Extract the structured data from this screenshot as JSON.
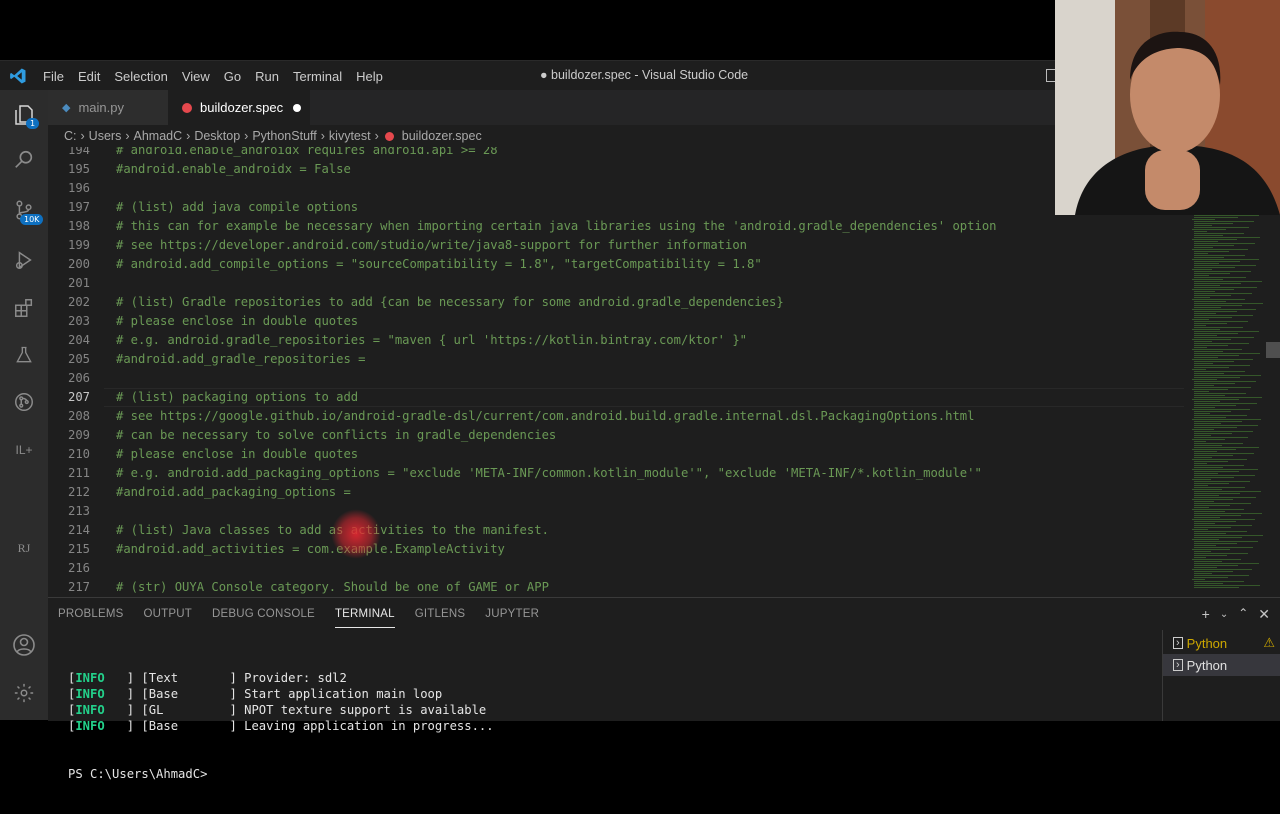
{
  "app": {
    "window_title": "● buildozer.spec - Visual Studio Code",
    "menu": [
      "File",
      "Edit",
      "Selection",
      "View",
      "Go",
      "Run",
      "Terminal",
      "Help"
    ]
  },
  "activity_bar": {
    "badges": {
      "explorer": "1",
      "source_control": "10K"
    },
    "extra_labels": {
      "il": "IL+",
      "rj": "RJ"
    }
  },
  "tabs": [
    {
      "label": "main.py",
      "active": false
    },
    {
      "label": "buildozer.spec",
      "active": true,
      "modified": true
    }
  ],
  "breadcrumb": [
    "C:",
    "Users",
    "AhmadC",
    "Desktop",
    "PythonStuff",
    "kivytest",
    "buildozer.spec"
  ],
  "editor": {
    "current_line": "207",
    "lines": [
      {
        "n": "194",
        "text": "# android.enable_androidx requires android.api >= 28"
      },
      {
        "n": "195",
        "text": "#android.enable_androidx = False"
      },
      {
        "n": "196",
        "text": ""
      },
      {
        "n": "197",
        "text": "# (list) add java compile options"
      },
      {
        "n": "198",
        "text": "# this can for example be necessary when importing certain java libraries using the 'android.gradle_dependencies' option"
      },
      {
        "n": "199",
        "text": "# see https://developer.android.com/studio/write/java8-support for further information"
      },
      {
        "n": "200",
        "text": "# android.add_compile_options = \"sourceCompatibility = 1.8\", \"targetCompatibility = 1.8\""
      },
      {
        "n": "201",
        "text": ""
      },
      {
        "n": "202",
        "text": "# (list) Gradle repositories to add {can be necessary for some android.gradle_dependencies}"
      },
      {
        "n": "203",
        "text": "# please enclose in double quotes"
      },
      {
        "n": "204",
        "text": "# e.g. android.gradle_repositories = \"maven { url 'https://kotlin.bintray.com/ktor' }\""
      },
      {
        "n": "205",
        "text": "#android.add_gradle_repositories ="
      },
      {
        "n": "206",
        "text": ""
      },
      {
        "n": "207",
        "text": "# (list) packaging options to add"
      },
      {
        "n": "208",
        "text": "# see https://google.github.io/android-gradle-dsl/current/com.android.build.gradle.internal.dsl.PackagingOptions.html"
      },
      {
        "n": "209",
        "text": "# can be necessary to solve conflicts in gradle_dependencies"
      },
      {
        "n": "210",
        "text": "# please enclose in double quotes"
      },
      {
        "n": "211",
        "text": "# e.g. android.add_packaging_options = \"exclude 'META-INF/common.kotlin_module'\", \"exclude 'META-INF/*.kotlin_module'\""
      },
      {
        "n": "212",
        "text": "#android.add_packaging_options ="
      },
      {
        "n": "213",
        "text": ""
      },
      {
        "n": "214",
        "text": "# (list) Java classes to add as activities to the manifest."
      },
      {
        "n": "215",
        "text": "#android.add_activities = com.example.ExampleActivity"
      },
      {
        "n": "216",
        "text": ""
      },
      {
        "n": "217",
        "text": "# (str) OUYA Console category. Should be one of GAME or APP"
      }
    ]
  },
  "panel": {
    "tabs": [
      "PROBLEMS",
      "OUTPUT",
      "DEBUG CONSOLE",
      "TERMINAL",
      "GITLENS",
      "JUPYTER"
    ],
    "active_tab": "TERMINAL",
    "terminal_lines": [
      {
        "tag": "INFO",
        "cat": "[Text       ]",
        "msg": "Provider: sdl2"
      },
      {
        "tag": "INFO",
        "cat": "[Base       ]",
        "msg": "Start application main loop"
      },
      {
        "tag": "INFO",
        "cat": "[GL         ]",
        "msg": "NPOT texture support is available"
      },
      {
        "tag": "INFO",
        "cat": "[Base       ]",
        "msg": "Leaving application in progress..."
      }
    ],
    "prompt": "PS C:\\Users\\AhmadC>",
    "terminals": [
      "Python",
      "Python"
    ]
  },
  "colors": {
    "accent": "#007acc",
    "comment": "#6a9955",
    "info": "#23d18b",
    "warning": "#cca700",
    "modified_tab_icon": "#e5484d"
  }
}
